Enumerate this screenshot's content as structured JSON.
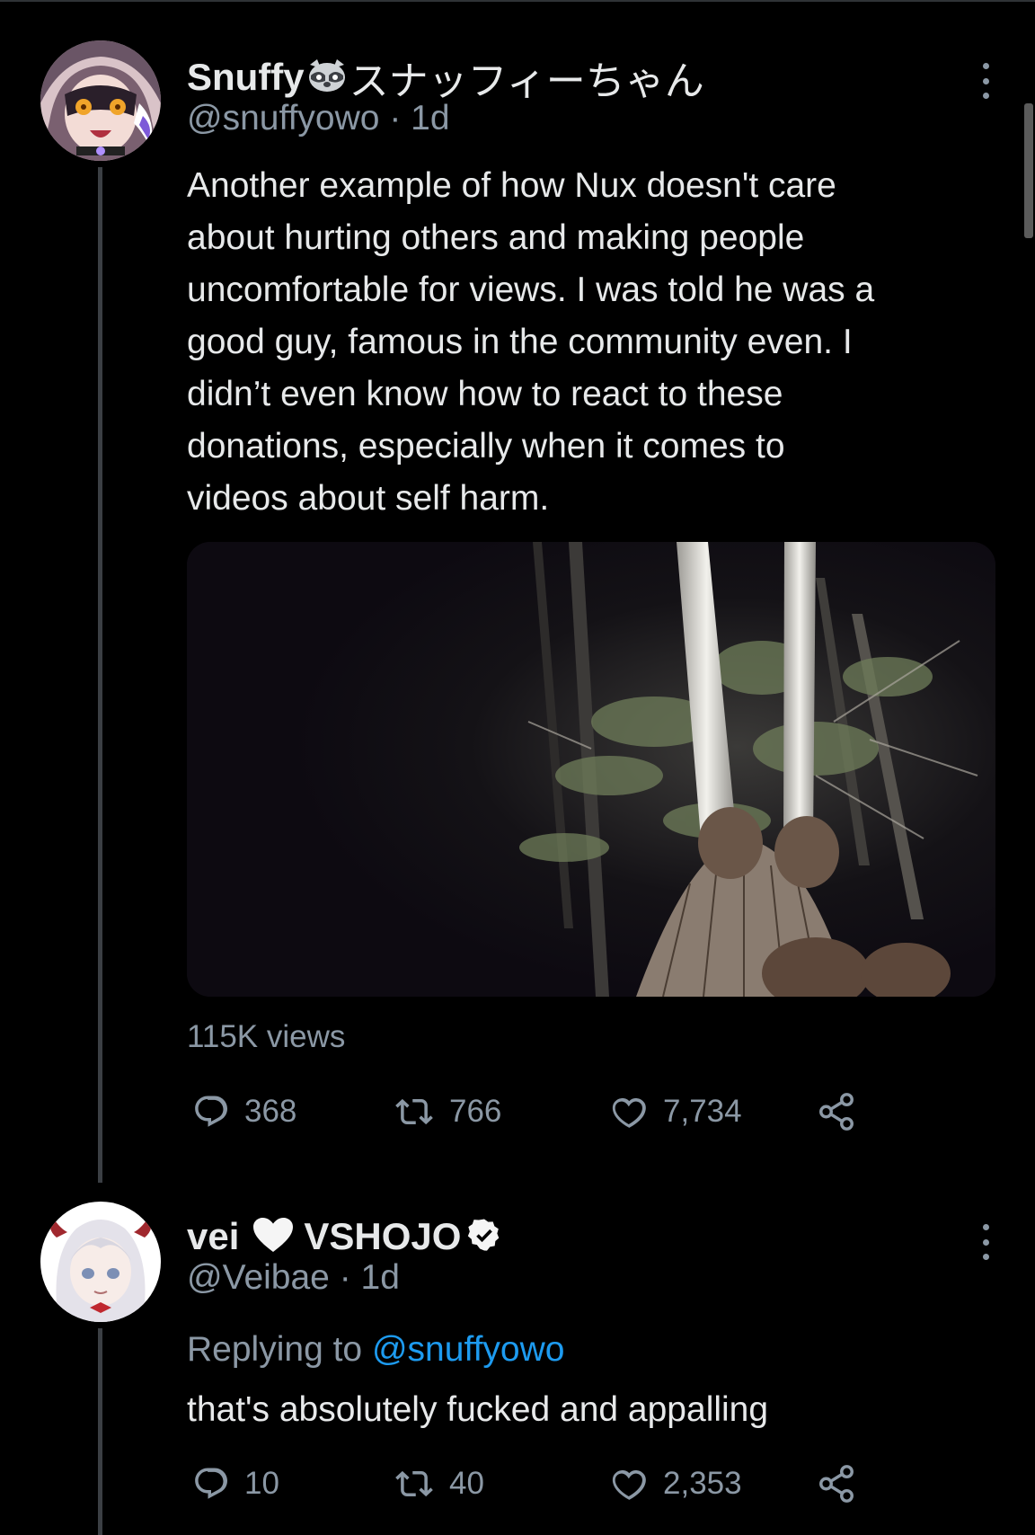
{
  "tweet1": {
    "display_name": "Snuffy",
    "name_jp": "スナッフィーちゃん",
    "handle_time": "@snuffyowo · 1d",
    "text_lines": [
      "Another example of how Nux doesn't care",
      "about hurting others and making people",
      "uncomfortable for views. I was told he was a",
      "good guy, famous in the community even. I",
      "didn’t even know how to react to these",
      "donations, especially when it comes to",
      "videos about self harm."
    ],
    "views": "115K views",
    "replies": "368",
    "retweets": "766",
    "likes": "7,734",
    "icons": [
      "raccoon-icon",
      "more-icon",
      "reply-icon",
      "retweet-icon",
      "like-icon",
      "share-icon"
    ]
  },
  "tweet2": {
    "display_name_a": "vei",
    "display_name_b": "VSHOJO",
    "handle_time": "@Veibae · 1d",
    "replying_label": "Replying to",
    "replying_handle": "@snuffyowo",
    "text": "that's absolutely fucked and appalling",
    "replies": "10",
    "retweets": "40",
    "likes": "2,353",
    "icons": [
      "white-heart-icon",
      "verified-badge-icon",
      "more-icon",
      "reply-icon",
      "retweet-icon",
      "like-icon",
      "share-icon"
    ]
  },
  "colors": {
    "background": "#000000",
    "text": "#e7e9ea",
    "secondary": "#8b98a5",
    "link": "#1d9bf0"
  }
}
